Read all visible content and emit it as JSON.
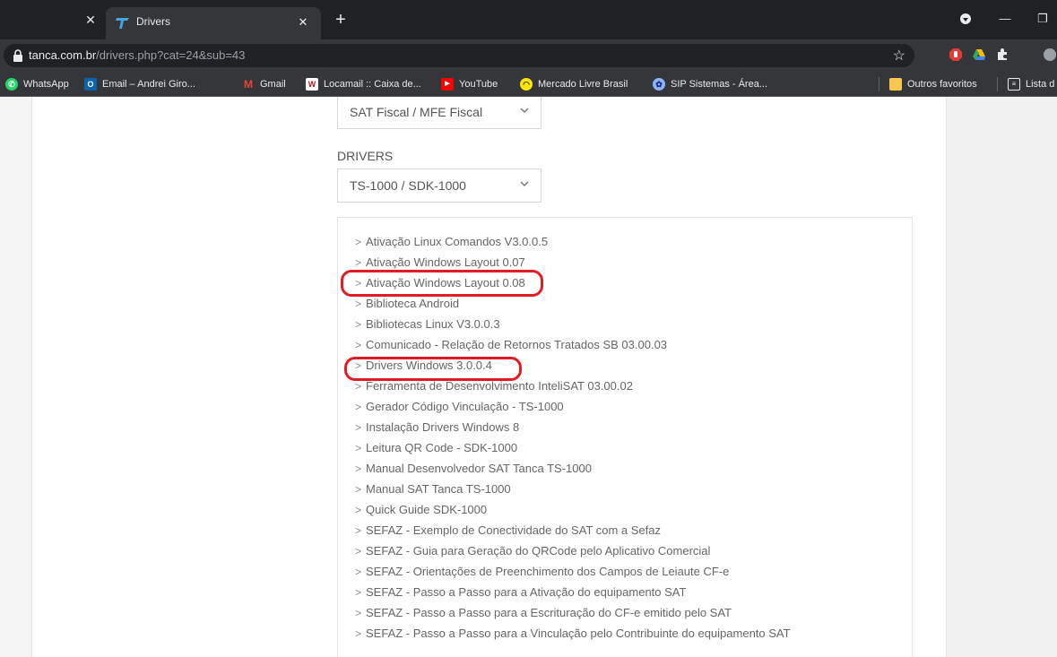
{
  "browser": {
    "active_tab_title": "Drivers",
    "url_host": "tanca.com.br",
    "url_path": "/drivers.php?cat=24&sub=43"
  },
  "bookmarks": [
    {
      "label": "WhatsApp",
      "icon": "whatsapp-icon"
    },
    {
      "label": "Email – Andrei Giro...",
      "icon": "outlook-icon"
    },
    {
      "label": "Gmail",
      "icon": "gmail-icon"
    },
    {
      "label": "Locamail :: Caixa de...",
      "icon": "locamail-icon"
    },
    {
      "label": "YouTube",
      "icon": "youtube-icon"
    },
    {
      "label": "Mercado Livre Brasil",
      "icon": "mercadolivre-icon"
    },
    {
      "label": "SIP Sistemas - Área...",
      "icon": "sip-icon"
    },
    {
      "label": "Outros favoritos",
      "icon": "folder-icon"
    },
    {
      "label": "Lista d",
      "icon": "reading-list-icon"
    }
  ],
  "page": {
    "category_select_value": "SAT Fiscal / MFE Fiscal",
    "drivers_label": "DRIVERS",
    "drivers_select_value": "TS-1000 / SDK-1000",
    "items": [
      "Ativação Linux Comandos V3.0.0.5",
      "Ativação Windows Layout 0.07",
      "Ativação Windows Layout 0.08",
      "Biblioteca Android",
      "Bibliotecas Linux V3.0.0.3",
      "Comunicado - Relação de Retornos Tratados SB 03.00.03",
      "Drivers Windows 3.0.0.4",
      "Ferramenta de Desenvolvimento InteliSAT 03.00.02",
      "Gerador Código Vinculação - TS-1000",
      "Instalação Drivers Windows 8",
      "Leitura QR Code - SDK-1000",
      "Manual Desenvolvedor SAT Tanca TS-1000",
      "Manual SAT Tanca TS-1000",
      "Quick Guide SDK-1000",
      "SEFAZ - Exemplo de Conectividade do SAT com a Sefaz",
      "SEFAZ - Guia para Geração do QRCode pelo Aplicativo Comercial",
      "SEFAZ - Orientações de Preenchimento dos Campos de Leiaute CF-e",
      "SEFAZ - Passo a Passo para a Ativação do equipamento SAT",
      "SEFAZ - Passo a Passo para a Escrituração do CF-e emitido pelo SAT",
      "SEFAZ - Passo a Passo para a Vinculação pelo Contribuinte do equipamento SAT"
    ],
    "highlight_color": "#e31b23"
  }
}
